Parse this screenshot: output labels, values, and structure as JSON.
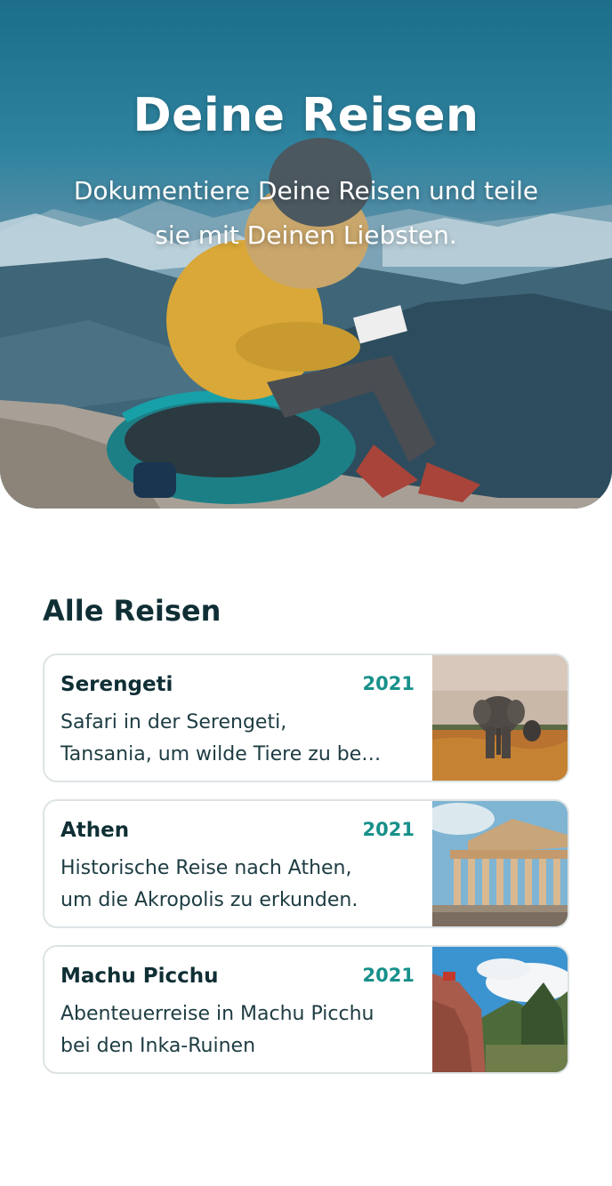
{
  "hero": {
    "title": "Deine Reisen",
    "subtitle_line1": "Dokumentiere Deine Reisen und teile",
    "subtitle_line2": "sie mit Deinen Liebsten."
  },
  "section": {
    "title": "Alle Reisen"
  },
  "trips": [
    {
      "name": "Serengeti",
      "year": "2021",
      "desc_line1": "Safari in der Serengeti,",
      "desc_line2": "Tansania, um wilde Tiere zu be…",
      "thumb_icon": "elephant-photo"
    },
    {
      "name": "Athen",
      "year": "2021",
      "desc_line1": "Historische Reise nach Athen,",
      "desc_line2": "um die Akropolis zu erkunden.",
      "thumb_icon": "parthenon-photo"
    },
    {
      "name": "Machu Picchu",
      "year": "2021",
      "desc_line1": "Abenteuerreise in Machu Picchu",
      "desc_line2": "bei den Inka-Ruinen",
      "thumb_icon": "machu-picchu-photo"
    }
  ],
  "colors": {
    "accent": "#17908a",
    "text_dark": "#0f2f35",
    "card_border": "#dde3e5"
  }
}
